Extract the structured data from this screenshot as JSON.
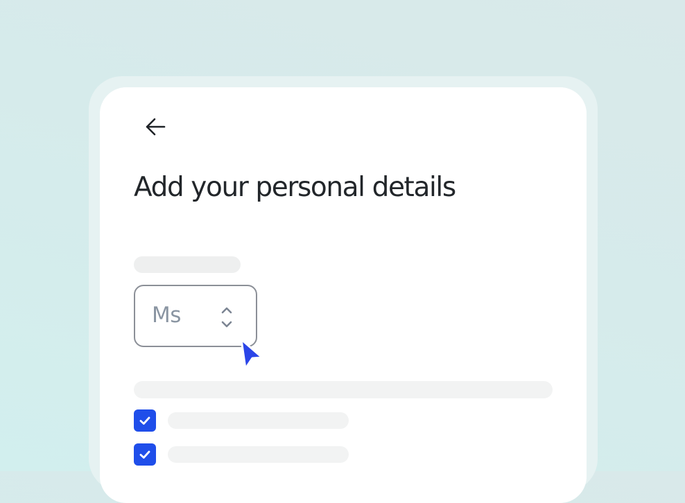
{
  "page": {
    "title": "Add your personal details"
  },
  "back_button": {
    "icon": "arrow-left-icon"
  },
  "title_select": {
    "value": "Ms",
    "icon": "chevron-up-down-icon"
  },
  "checkboxes": [
    {
      "checked": true
    },
    {
      "checked": true
    }
  ],
  "colors": {
    "accent": "#1f4eea",
    "title_text": "#22262a",
    "select_text": "#8a95a2",
    "select_border": "#8b8f97",
    "skeleton": "#eeefef",
    "background": "#d6ebeb",
    "card": "#ffffff"
  }
}
